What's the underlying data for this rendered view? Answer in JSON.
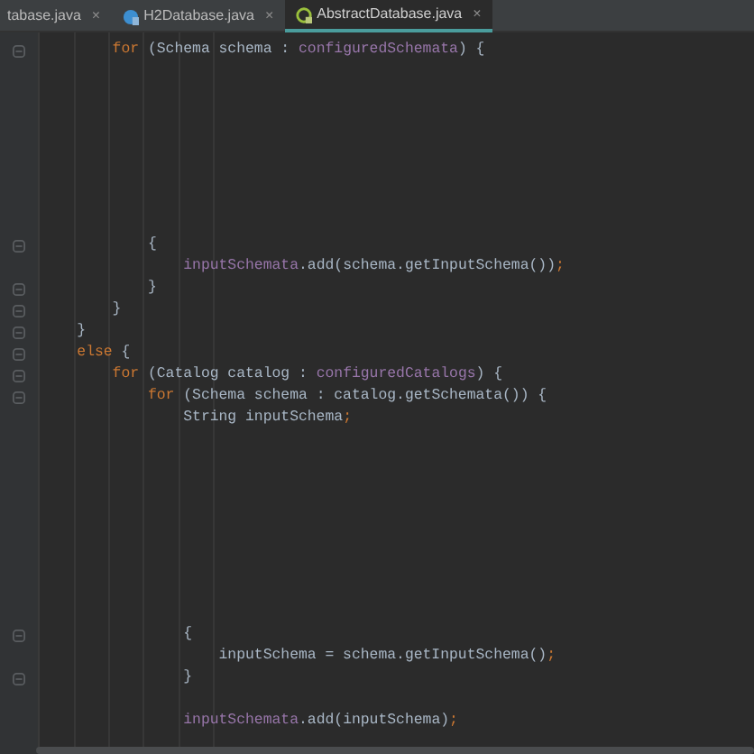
{
  "tabs": [
    {
      "label": "tabase.java",
      "kind": "clipped",
      "selected": false
    },
    {
      "label": "H2Database.java",
      "kind": "class",
      "selected": false
    },
    {
      "label": "AbstractDatabase.java",
      "kind": "abstract",
      "selected": true
    }
  ],
  "close_glyph": "×",
  "lines": [
    {
      "fold": true,
      "segments": [
        {
          "text": "        for",
          "kind": "keyword"
        },
        {
          "text": " (Schema schema : ",
          "kind": "plain"
        },
        {
          "text": "configuredSchemata",
          "kind": "field"
        },
        {
          "text": ") {",
          "kind": "plain"
        }
      ]
    },
    {
      "fold": false
    },
    {
      "fold": false
    },
    {
      "fold": false
    },
    {
      "fold": false
    },
    {
      "fold": false
    },
    {
      "fold": false
    },
    {
      "fold": false
    },
    {
      "fold": false
    },
    {
      "fold": true,
      "segments": [
        {
          "text": "            {",
          "kind": "plain"
        }
      ]
    },
    {
      "fold": false,
      "segments": [
        {
          "text": "                inputSchemata",
          "kind": "field"
        },
        {
          "text": ".add(schema.getInputSchema())",
          "kind": "plain"
        },
        {
          "text": ";",
          "kind": "keyword"
        }
      ]
    },
    {
      "fold": true,
      "segments": [
        {
          "text": "            }",
          "kind": "plain"
        }
      ]
    },
    {
      "fold": true,
      "segments": [
        {
          "text": "        }",
          "kind": "plain"
        }
      ]
    },
    {
      "fold": true,
      "segments": [
        {
          "text": "    }",
          "kind": "plain"
        }
      ]
    },
    {
      "fold": true,
      "segments": [
        {
          "text": "    else",
          "kind": "keyword"
        },
        {
          "text": " {",
          "kind": "plain"
        }
      ]
    },
    {
      "fold": true,
      "segments": [
        {
          "text": "        for",
          "kind": "keyword"
        },
        {
          "text": " (Catalog catalog : ",
          "kind": "plain"
        },
        {
          "text": "configuredCatalogs",
          "kind": "field"
        },
        {
          "text": ") {",
          "kind": "plain"
        }
      ]
    },
    {
      "fold": true,
      "segments": [
        {
          "text": "            for",
          "kind": "keyword"
        },
        {
          "text": " (Schema schema : catalog.getSchemata()) {",
          "kind": "plain"
        }
      ]
    },
    {
      "fold": false,
      "segments": [
        {
          "text": "                String inputSchema",
          "kind": "plain"
        },
        {
          "text": ";",
          "kind": "keyword"
        }
      ]
    },
    {
      "fold": false
    },
    {
      "fold": false
    },
    {
      "fold": false
    },
    {
      "fold": false
    },
    {
      "fold": false
    },
    {
      "fold": false
    },
    {
      "fold": false
    },
    {
      "fold": false
    },
    {
      "fold": false
    },
    {
      "fold": true,
      "segments": [
        {
          "text": "                {",
          "kind": "plain"
        }
      ]
    },
    {
      "fold": false,
      "segments": [
        {
          "text": "                    inputSchema = schema.getInputSchema()",
          "kind": "plain"
        },
        {
          "text": ";",
          "kind": "keyword"
        }
      ]
    },
    {
      "fold": true,
      "segments": [
        {
          "text": "                }",
          "kind": "plain"
        }
      ]
    },
    {
      "fold": false
    },
    {
      "fold": false,
      "segments": [
        {
          "text": "                inputSchemata",
          "kind": "field"
        },
        {
          "text": ".add(inputSchema)",
          "kind": "plain"
        },
        {
          "text": ";",
          "kind": "keyword"
        }
      ]
    }
  ]
}
